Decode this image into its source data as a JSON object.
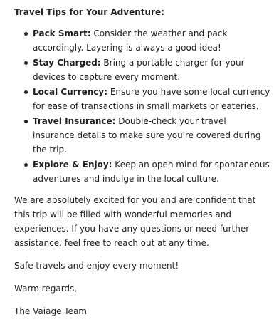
{
  "email": {
    "tips_heading": "Travel Tips for Your Adventure:",
    "tips": [
      {
        "title": "Pack Smart:",
        "text": " Consider the weather and pack accordingly. Layering is always a good idea!"
      },
      {
        "title": "Stay Charged:",
        "text": " Bring a portable charger for your devices to capture every moment."
      },
      {
        "title": "Local Currency:",
        "text": " Ensure you have some local currency for ease of transactions in small markets or eateries."
      },
      {
        "title": "Travel Insurance:",
        "text": " Double-check your travel insurance details to make sure you're covered during the trip."
      },
      {
        "title": "Explore & Enjoy:",
        "text": " Keep an open mind for spontaneous adventures and indulge in the local culture."
      }
    ],
    "closing_paragraph": "We are absolutely excited for you and are confident that this trip will be filled with wonderful memories and experiences. If you have any questions or need further assistance, feel free to reach out at any time.",
    "farewell": "Safe travels and enjoy every moment!",
    "signoff": "Warm regards,",
    "signature": "The Vaiage Team"
  },
  "colors": {
    "text": "#1f1f1f",
    "background": "#ffffff"
  }
}
